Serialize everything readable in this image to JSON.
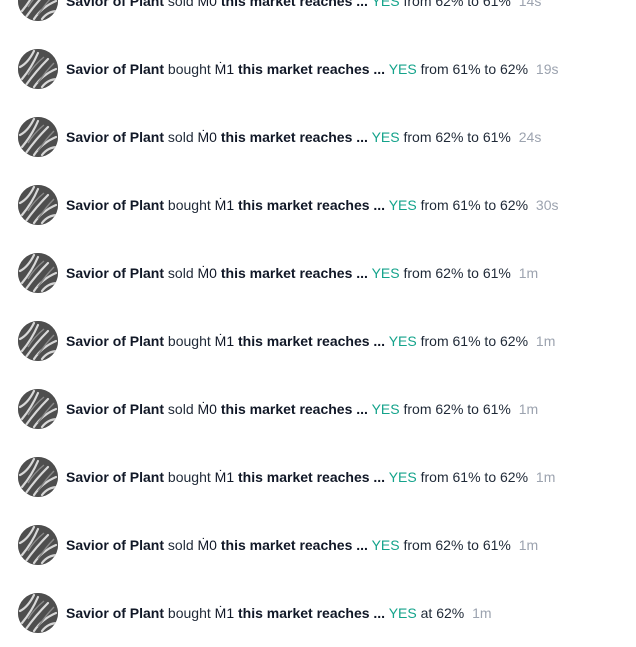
{
  "feed": {
    "items": [
      {
        "user": "Savior of Plant",
        "action": "sold",
        "currency": "Ṁ",
        "amount": "0",
        "question": "this market reaches ...",
        "outcome": "YES",
        "change": "from 62% to 61%",
        "time": "14s"
      },
      {
        "user": "Savior of Plant",
        "action": "bought",
        "currency": "Ṁ",
        "amount": "1",
        "question": "this market reaches ...",
        "outcome": "YES",
        "change": "from 61% to 62%",
        "time": "19s"
      },
      {
        "user": "Savior of Plant",
        "action": "sold",
        "currency": "Ṁ",
        "amount": "0",
        "question": "this market reaches ...",
        "outcome": "YES",
        "change": "from 62% to 61%",
        "time": "24s"
      },
      {
        "user": "Savior of Plant",
        "action": "bought",
        "currency": "Ṁ",
        "amount": "1",
        "question": "this market reaches ...",
        "outcome": "YES",
        "change": "from 61% to 62%",
        "time": "30s"
      },
      {
        "user": "Savior of Plant",
        "action": "sold",
        "currency": "Ṁ",
        "amount": "0",
        "question": "this market reaches ...",
        "outcome": "YES",
        "change": "from 62% to 61%",
        "time": "1m"
      },
      {
        "user": "Savior of Plant",
        "action": "bought",
        "currency": "Ṁ",
        "amount": "1",
        "question": "this market reaches ...",
        "outcome": "YES",
        "change": "from 61% to 62%",
        "time": "1m"
      },
      {
        "user": "Savior of Plant",
        "action": "sold",
        "currency": "Ṁ",
        "amount": "0",
        "question": "this market reaches ...",
        "outcome": "YES",
        "change": "from 62% to 61%",
        "time": "1m"
      },
      {
        "user": "Savior of Plant",
        "action": "bought",
        "currency": "Ṁ",
        "amount": "1",
        "question": "this market reaches ...",
        "outcome": "YES",
        "change": "from 61% to 62%",
        "time": "1m"
      },
      {
        "user": "Savior of Plant",
        "action": "sold",
        "currency": "Ṁ",
        "amount": "0",
        "question": "this market reaches ...",
        "outcome": "YES",
        "change": "from 62% to 61%",
        "time": "1m"
      },
      {
        "user": "Savior of Plant",
        "action": "bought",
        "currency": "Ṁ",
        "amount": "1",
        "question": "this market reaches ...",
        "outcome": "YES",
        "change": "at 62%",
        "time": "1m"
      }
    ]
  },
  "colors": {
    "outcome_yes": "#14a38b",
    "time": "#9ca3af",
    "text": "#111827"
  },
  "icons": {
    "avatar": "plant-avatar-icon"
  }
}
